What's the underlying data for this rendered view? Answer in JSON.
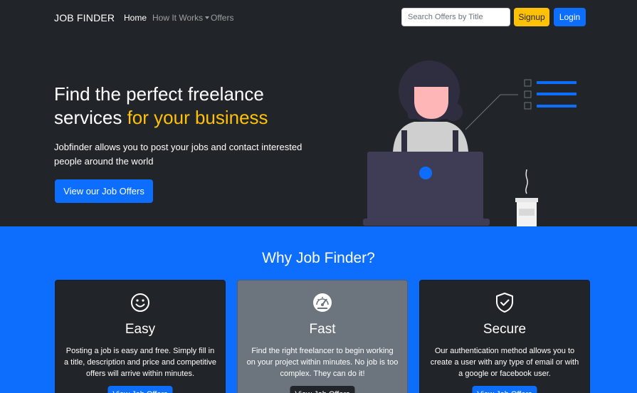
{
  "navbar": {
    "brand": "JOB FINDER",
    "links": [
      {
        "label": "Home"
      },
      {
        "label": "How It Works"
      },
      {
        "label": "Offers"
      }
    ],
    "search_placeholder": "Search Offers by Title",
    "signup_label": "Signup",
    "login_label": "Login"
  },
  "hero": {
    "title_line1": "Find the perfect freelance",
    "title_line2_plain": "services ",
    "title_line2_accent": "for your business",
    "description": "Jobfinder allows you to post your jobs and contact interested people around the world",
    "cta_label": "View our Job Offers"
  },
  "features": {
    "title": "Why Job Finder?",
    "cards": [
      {
        "icon": "smile-icon",
        "title": "Easy",
        "text": "Posting a job is easy and free. Simply fill in a title, description and price and competitive offers will arrive within minutes.",
        "button": "View Job Offers"
      },
      {
        "icon": "speedometer-icon",
        "title": "Fast",
        "text": "Find the right freelancer to begin working on your project within minutes. No job is too complex. They can do it!",
        "button": "View Job Offers"
      },
      {
        "icon": "shield-check-icon",
        "title": "Secure",
        "text": "Our authentication method allows you to create a user with any type of email or with a google or facebook user.",
        "button": "View Job Offers"
      }
    ]
  },
  "colors": {
    "dark": "#212529",
    "primary": "#0d6efd",
    "warning": "#ffc107",
    "secondary": "#6c757d"
  }
}
